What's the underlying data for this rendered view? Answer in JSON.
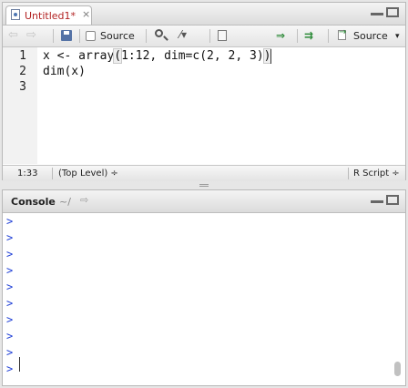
{
  "editor": {
    "tab": {
      "title": "Untitled1*",
      "close_glyph": "×"
    },
    "toolbar": {
      "back_glyph": "⇦",
      "forward_glyph": "⇨",
      "source_on_save_label": "Source",
      "run_glyph": "⇒",
      "rerun_glyph": "⇉",
      "source_label": "Source",
      "source_dropdown_glyph": "▾",
      "wand_glyph": "⁄▾"
    },
    "line_numbers": [
      "1",
      "2",
      "3"
    ],
    "code_lines": [
      {
        "before": "x <- array",
        "paren": "(",
        "after": "1:12, dim=c(2, 2, 3)",
        "close": ")"
      },
      {
        "text": "dim(x)"
      },
      {
        "text": ""
      }
    ],
    "status": {
      "position": "1:33",
      "scope": "(Top Level) ÷",
      "filetype": "R Script ÷"
    }
  },
  "console": {
    "title": "Console",
    "path": "~/",
    "path_arrow": "⇨",
    "prompts": [
      ">",
      ">",
      ">",
      ">",
      ">",
      ">",
      ">",
      ">",
      ">",
      ">"
    ]
  }
}
